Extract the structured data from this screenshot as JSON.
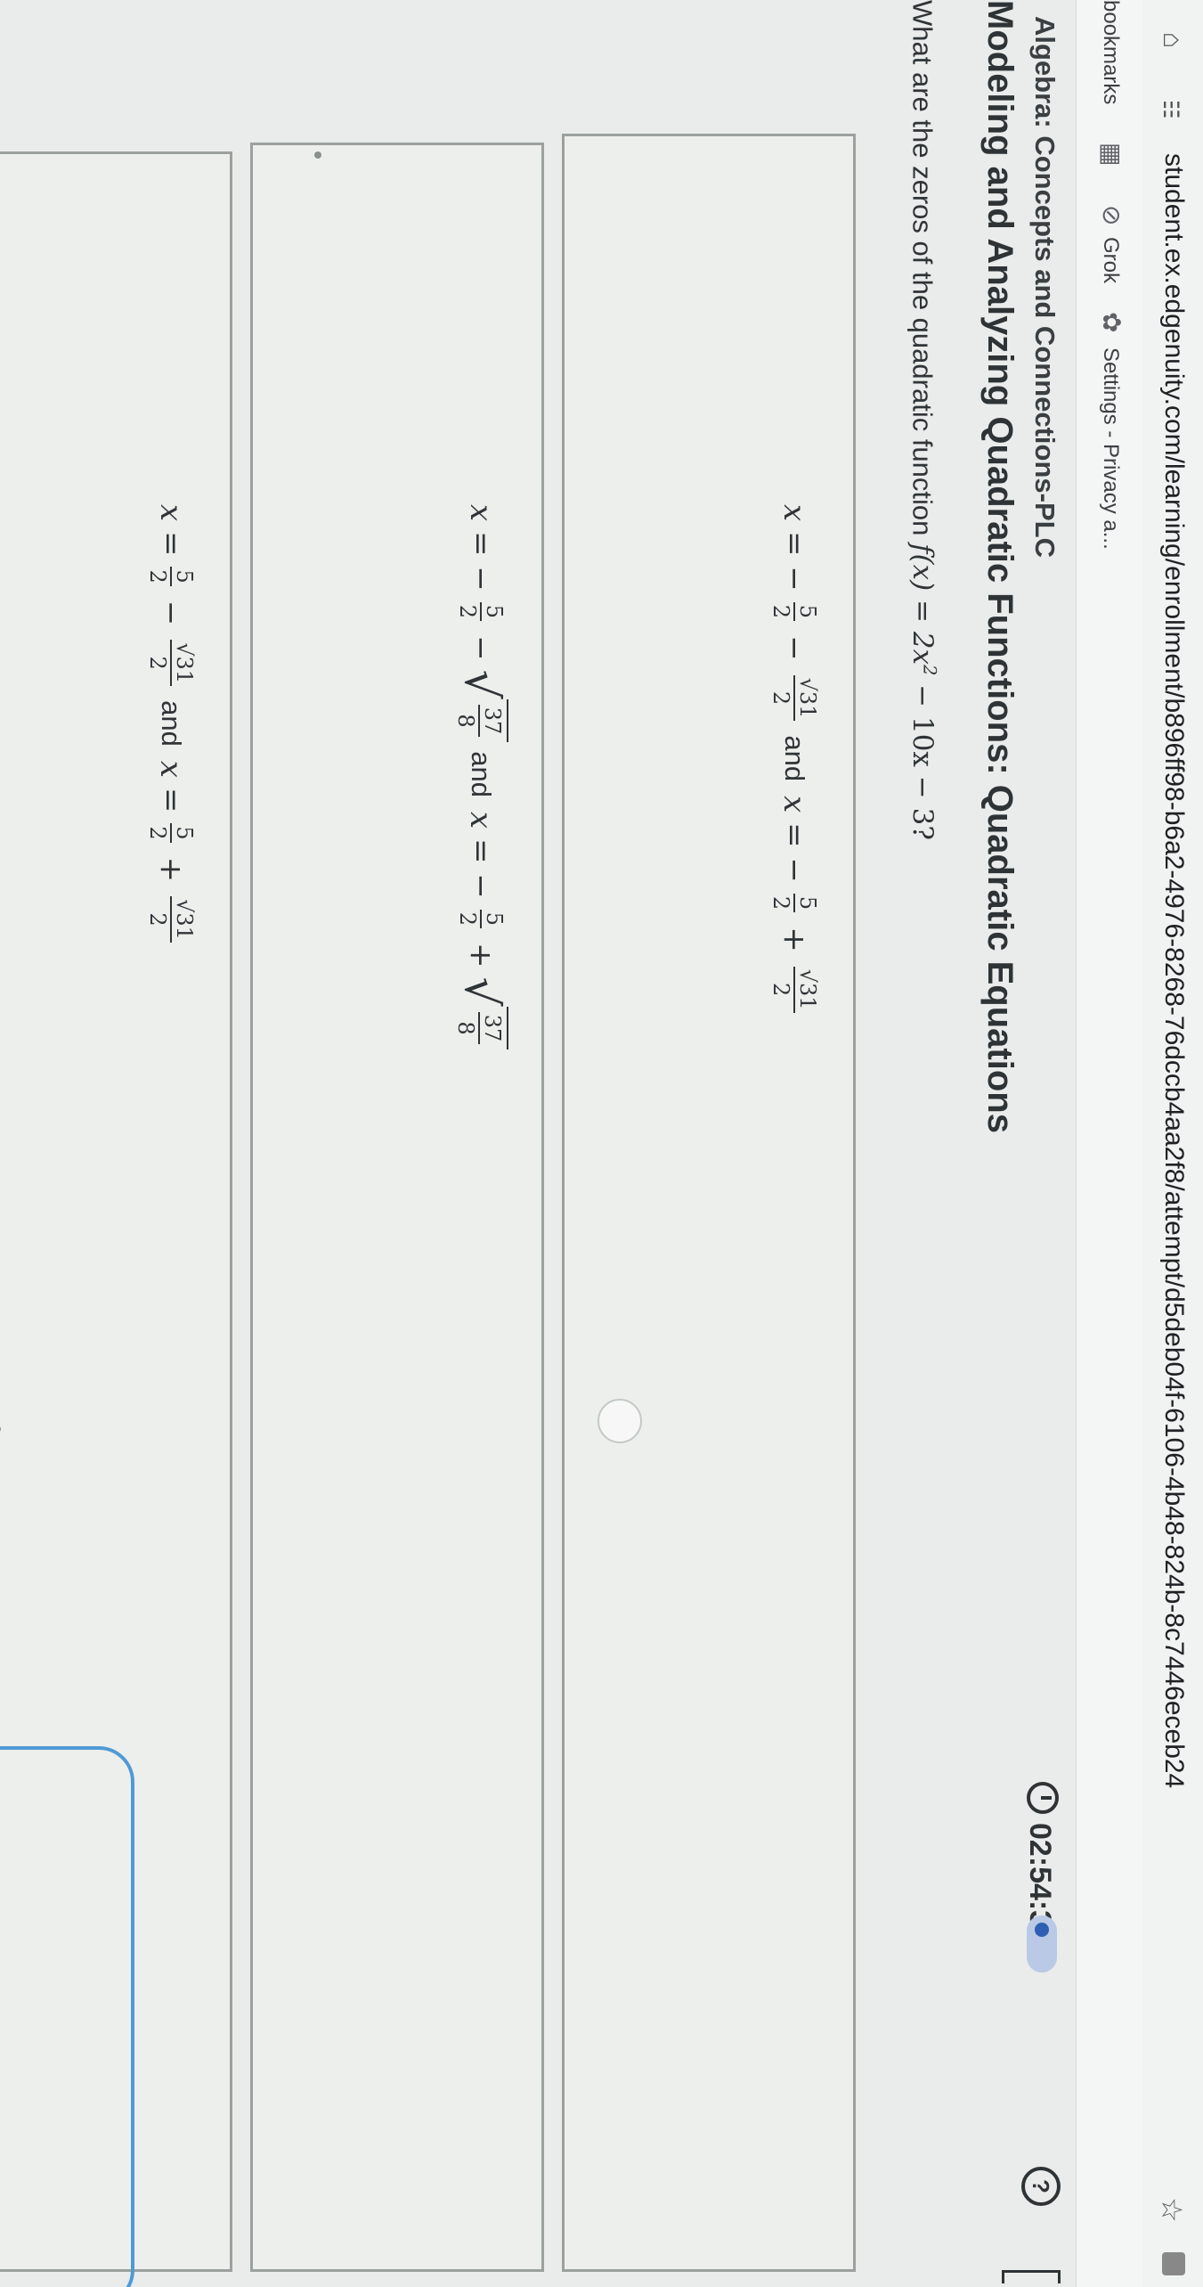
{
  "browser": {
    "url": "student.ex.edgenuity.com/learning/enrollment/b896ff98-b6a2-4976-8268-76dccb4aa2f8/attempt/d5deb04f-6106-4b48-824b-8c7446eceb24",
    "bookmarks": [
      {
        "label": "bookmarks"
      },
      {
        "label": "Grok"
      },
      {
        "label": "Settings - Privacy a..."
      }
    ]
  },
  "header": {
    "course": "Algebra: Concepts and Connections-PLC",
    "lesson": "Modeling and Analyzing Quadratic Functions: Quadratic Equations",
    "timer": "02:54:36"
  },
  "question": {
    "prompt": "What are the zeros of the quadratic function",
    "function_lhs": "f(x) = 2x",
    "exponent": "2",
    "function_rhs": " − 10x − 3?"
  },
  "options": [
    {
      "lead": "x = −",
      "f1_num": "5",
      "f1_den": "2",
      "op1": "−",
      "f2_num": "√31",
      "f2_den": "2",
      "and": "and",
      "lead2": "x = −",
      "f3_num": "5",
      "f3_den": "2",
      "op2": "+",
      "f4_num": "√31",
      "f4_den": "2"
    },
    {
      "lead": "x = −",
      "f1_num": "5",
      "f1_den": "2",
      "op1": "−",
      "r1_num": "37",
      "r1_den": "8",
      "and": "and",
      "lead2": "x = −",
      "f3_num": "5",
      "f3_den": "2",
      "op2": "+",
      "r2_num": "37",
      "r2_den": "8"
    },
    {
      "lead": "x =",
      "f1_num": "5",
      "f1_den": "2",
      "op1": "−",
      "f2_num": "√31",
      "f2_den": "2",
      "and": "and",
      "lead2": "x =",
      "f3_num": "5",
      "f3_den": "2",
      "op2": "+",
      "f4_num": "√31",
      "f4_den": "2"
    }
  ]
}
